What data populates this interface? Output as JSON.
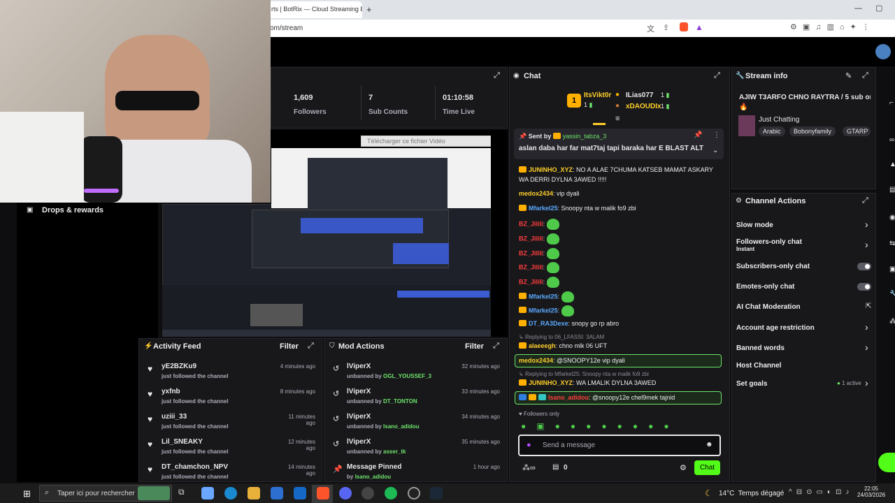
{
  "browser": {
    "tab_title": "rts | BotRix — Cloud Streaming Bo",
    "url": "om/stream"
  },
  "stats": [
    {
      "value": "1,609",
      "label": "Followers"
    },
    {
      "value": "7",
      "label": "Sub Counts"
    },
    {
      "value": "01:10:58",
      "label": "Time Live"
    }
  ],
  "preview": {
    "download_banner": "Télécharger ce fichier Vidéo"
  },
  "drops": {
    "title": "Drops & rewards"
  },
  "activity": {
    "title": "Activity Feed",
    "filter": "Filter",
    "items": [
      {
        "name": "yE2BZKu9",
        "time": "4 minutes ago",
        "sub": "just followed the channel"
      },
      {
        "name": "yxfnb",
        "time": "8 minutes ago",
        "sub": "just followed the channel"
      },
      {
        "name": "uziii_33",
        "time": "11 minutes ago",
        "sub": "just followed the channel"
      },
      {
        "name": "Lil_SNEAKY",
        "time": "12 minutes ago",
        "sub": "just followed the channel"
      },
      {
        "name": "DT_chamchon_NPV",
        "time": "14 minutes ago",
        "sub": "just followed the channel"
      }
    ]
  },
  "mod": {
    "title": "Mod Actions",
    "filter": "Filter",
    "items": [
      {
        "name": "lViperX",
        "time": "32 minutes ago",
        "action": "unbanned by",
        "by": "OGL_YOUSSEF_3"
      },
      {
        "name": "lViperX",
        "time": "33 minutes ago",
        "action": "unbanned by",
        "by": "DT_TONTON"
      },
      {
        "name": "lViperX",
        "time": "34 minutes ago",
        "action": "unbanned by",
        "by": "Isano_adidou"
      },
      {
        "name": "lViperX",
        "time": "35 minutes ago",
        "action": "unbanned by",
        "by": "asser_tk"
      },
      {
        "name": "Message Pinned",
        "time": "1 hour ago",
        "action": "by",
        "by": "Isano_adidou"
      }
    ]
  },
  "chat": {
    "title": "Chat",
    "top": [
      {
        "rank": "1",
        "name": "ItsVikt0r",
        "count": "1"
      },
      {
        "rank": "",
        "name": "ILias077",
        "count": "1"
      },
      {
        "rank": "",
        "name": "xDAOUDIx",
        "count": "1"
      }
    ],
    "pinned": {
      "sent_by": "Sent by",
      "user": "yassin_tabza_3",
      "text": "aslan daba har far mat7taj tapi baraka har E BLAST ALT"
    },
    "messages": [
      {
        "user": "JUNINHO_XYZ",
        "text": "NO A ALAE 7CHUMA KATSEB MAMAT ASKARY",
        "text2": "WA DERRI DYLNA 3AWED !!!!!",
        "color": "#ffd02a",
        "badge": "crown"
      },
      {
        "user": "medox2434",
        "text": "vip dyali",
        "color": "#ffd02a",
        "badge": ""
      },
      {
        "user": "Mfarkel25",
        "text": "Snoopy nta w malik fo9 zbi",
        "color": "#5aa9ff",
        "badge": "crown"
      },
      {
        "user": "BZ_Jilili",
        "text": "",
        "color": "#ff3c3c",
        "badge": "emote"
      },
      {
        "user": "BZ_Jilili",
        "text": "",
        "color": "#ff3c3c",
        "badge": "emote"
      },
      {
        "user": "BZ_Jilili",
        "text": "",
        "color": "#ff3c3c",
        "badge": "emote"
      },
      {
        "user": "BZ_Jilili",
        "text": "",
        "color": "#ff3c3c",
        "badge": "emote"
      },
      {
        "user": "BZ_Jilili",
        "text": "",
        "color": "#ff3c3c",
        "badge": "emote"
      },
      {
        "user": "Mfarkel25",
        "text": "",
        "color": "#5aa9ff",
        "badge": "crown"
      },
      {
        "user": "Mfarkel25",
        "text": "",
        "color": "#5aa9ff",
        "badge": "crown"
      },
      {
        "user": "DT_RA3Dexe",
        "text": "snopy go rp abro",
        "color": "#5aa9ff",
        "badge": "crown"
      }
    ],
    "reply1": "Replying to 06_LFASSI: 3ALAM",
    "msg_alaeeegh": {
      "user": "alaeeegh",
      "text": "chno mlk 06 UFT"
    },
    "highlight1": {
      "user": "medox2434",
      "text": "@SNOOPY12e vip dyali"
    },
    "reply2": "Replying to Mfarkel25: Snoopy nta w malik fo9 zbi",
    "msg_jun2": {
      "user": "JUNINHO_XYZ",
      "text": "WA LMALIK DYLNA 3AWED"
    },
    "highlight2": {
      "user": "Isano_adidou",
      "text": "@snoopy12e chel9mek tajnid"
    },
    "followers_only": "Followers only",
    "input_placeholder": "Send a message",
    "viewers": "0",
    "send": "Chat",
    "reply_top": "Replying to ..."
  },
  "stream_info": {
    "title": "Stream info",
    "stream_title": "AJIW T3ARFO CHNO RAYTRA / 5 sub on",
    "category": "Just Chatting",
    "tags": [
      "Arabic",
      "Bobonyfamily",
      "GTARP"
    ]
  },
  "channel_actions": {
    "title": "Channel Actions",
    "items": [
      {
        "label": "Slow mode",
        "sub": ""
      },
      {
        "label": "Followers-only chat",
        "sub": "Instant"
      },
      {
        "label": "Subscribers-only chat",
        "sub": ""
      },
      {
        "label": "Emotes-only chat",
        "sub": ""
      },
      {
        "label": "AI Chat Moderation",
        "sub": ""
      },
      {
        "label": "Account age restriction",
        "sub": ""
      },
      {
        "label": "Banned words",
        "sub": ""
      },
      {
        "label": "Host Channel",
        "sub": ""
      },
      {
        "label": "Set goals",
        "sub": "1 active"
      }
    ]
  },
  "taskbar": {
    "search": "Taper ici pour rechercher",
    "weather": "14°C  Temps dégagé",
    "time": "22:05",
    "date": "24/03/2026"
  }
}
